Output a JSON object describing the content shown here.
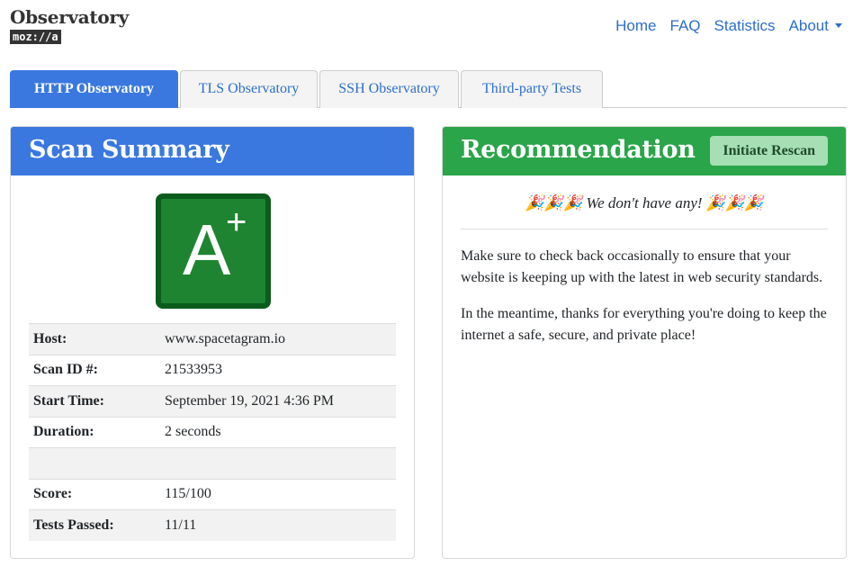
{
  "brand": {
    "title": "Observatory",
    "logo": "moz://a"
  },
  "nav": {
    "items": [
      "Home",
      "FAQ",
      "Statistics",
      "About"
    ]
  },
  "tabs": [
    "HTTP Observatory",
    "TLS Observatory",
    "SSH Observatory",
    "Third-party Tests"
  ],
  "summary": {
    "title": "Scan Summary",
    "grade": "A",
    "grade_modifier": "+",
    "rows": [
      {
        "label": "Host:",
        "value": "www.spacetagram.io"
      },
      {
        "label": "Scan ID #:",
        "value": "21533953"
      },
      {
        "label": "Start Time:",
        "value": "September 19, 2021 4:36 PM"
      },
      {
        "label": "Duration:",
        "value": "2 seconds"
      },
      {
        "label": "",
        "value": ""
      },
      {
        "label": "Score:",
        "value": "115/100"
      },
      {
        "label": "Tests Passed:",
        "value": "11/11"
      }
    ]
  },
  "recommendation": {
    "title": "Recommendation",
    "rescan_label": "Initiate Rescan",
    "note": "🎉🎉🎉  We don't have any!  🎉🎉🎉",
    "paragraphs": [
      "Make sure to check back occasionally to ensure that your website is keeping up with the latest in web security standards.",
      "In the meantime, thanks for everything you're doing to keep the internet a safe, secure, and private place!"
    ]
  },
  "colors": {
    "accent": "#3a78e0",
    "success": "#2aa54a",
    "grade_bg": "#1e8431",
    "link": "#2d6ecb"
  },
  "icons": {
    "about_dropdown": "caret-down-icon",
    "celebration": "party-popper-icon"
  }
}
